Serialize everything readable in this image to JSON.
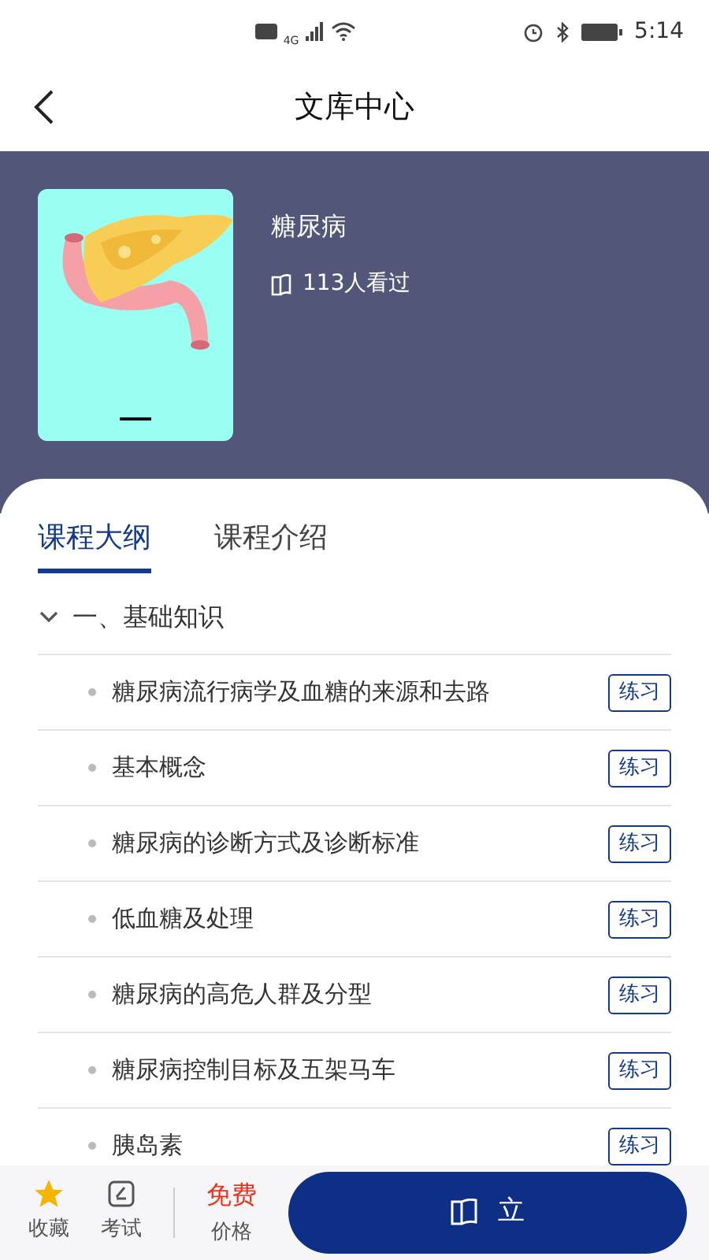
{
  "status_bar": {
    "time": "5:14",
    "network": "4G"
  },
  "header": {
    "title": "文库中心"
  },
  "course": {
    "title": "糖尿病",
    "views": "113人看过"
  },
  "tabs": [
    {
      "label": "课程大纲",
      "selected": true
    },
    {
      "label": "课程介绍",
      "selected": false
    }
  ],
  "outline": [
    {
      "title": "一、基础知识",
      "expanded": true,
      "children": [
        {
          "title": "糖尿病流行病学及血糖的来源和去路",
          "action": "练习"
        },
        {
          "title": "基本概念",
          "action": "练习"
        },
        {
          "title": "糖尿病的诊断方式及诊断标准",
          "action": "练习"
        },
        {
          "title": "低血糖及处理",
          "action": "练习"
        },
        {
          "title": "糖尿病的高危人群及分型",
          "action": "练习"
        },
        {
          "title": "糖尿病控制目标及五架马车",
          "action": "练习"
        },
        {
          "title": "胰岛素",
          "action": "练习"
        }
      ]
    }
  ],
  "bottom_bar": {
    "favorite": {
      "label": "收藏",
      "on": true
    },
    "exam": {
      "label": "考试"
    },
    "price": {
      "value": "免费",
      "label": "价格"
    },
    "primary_button": "立"
  }
}
